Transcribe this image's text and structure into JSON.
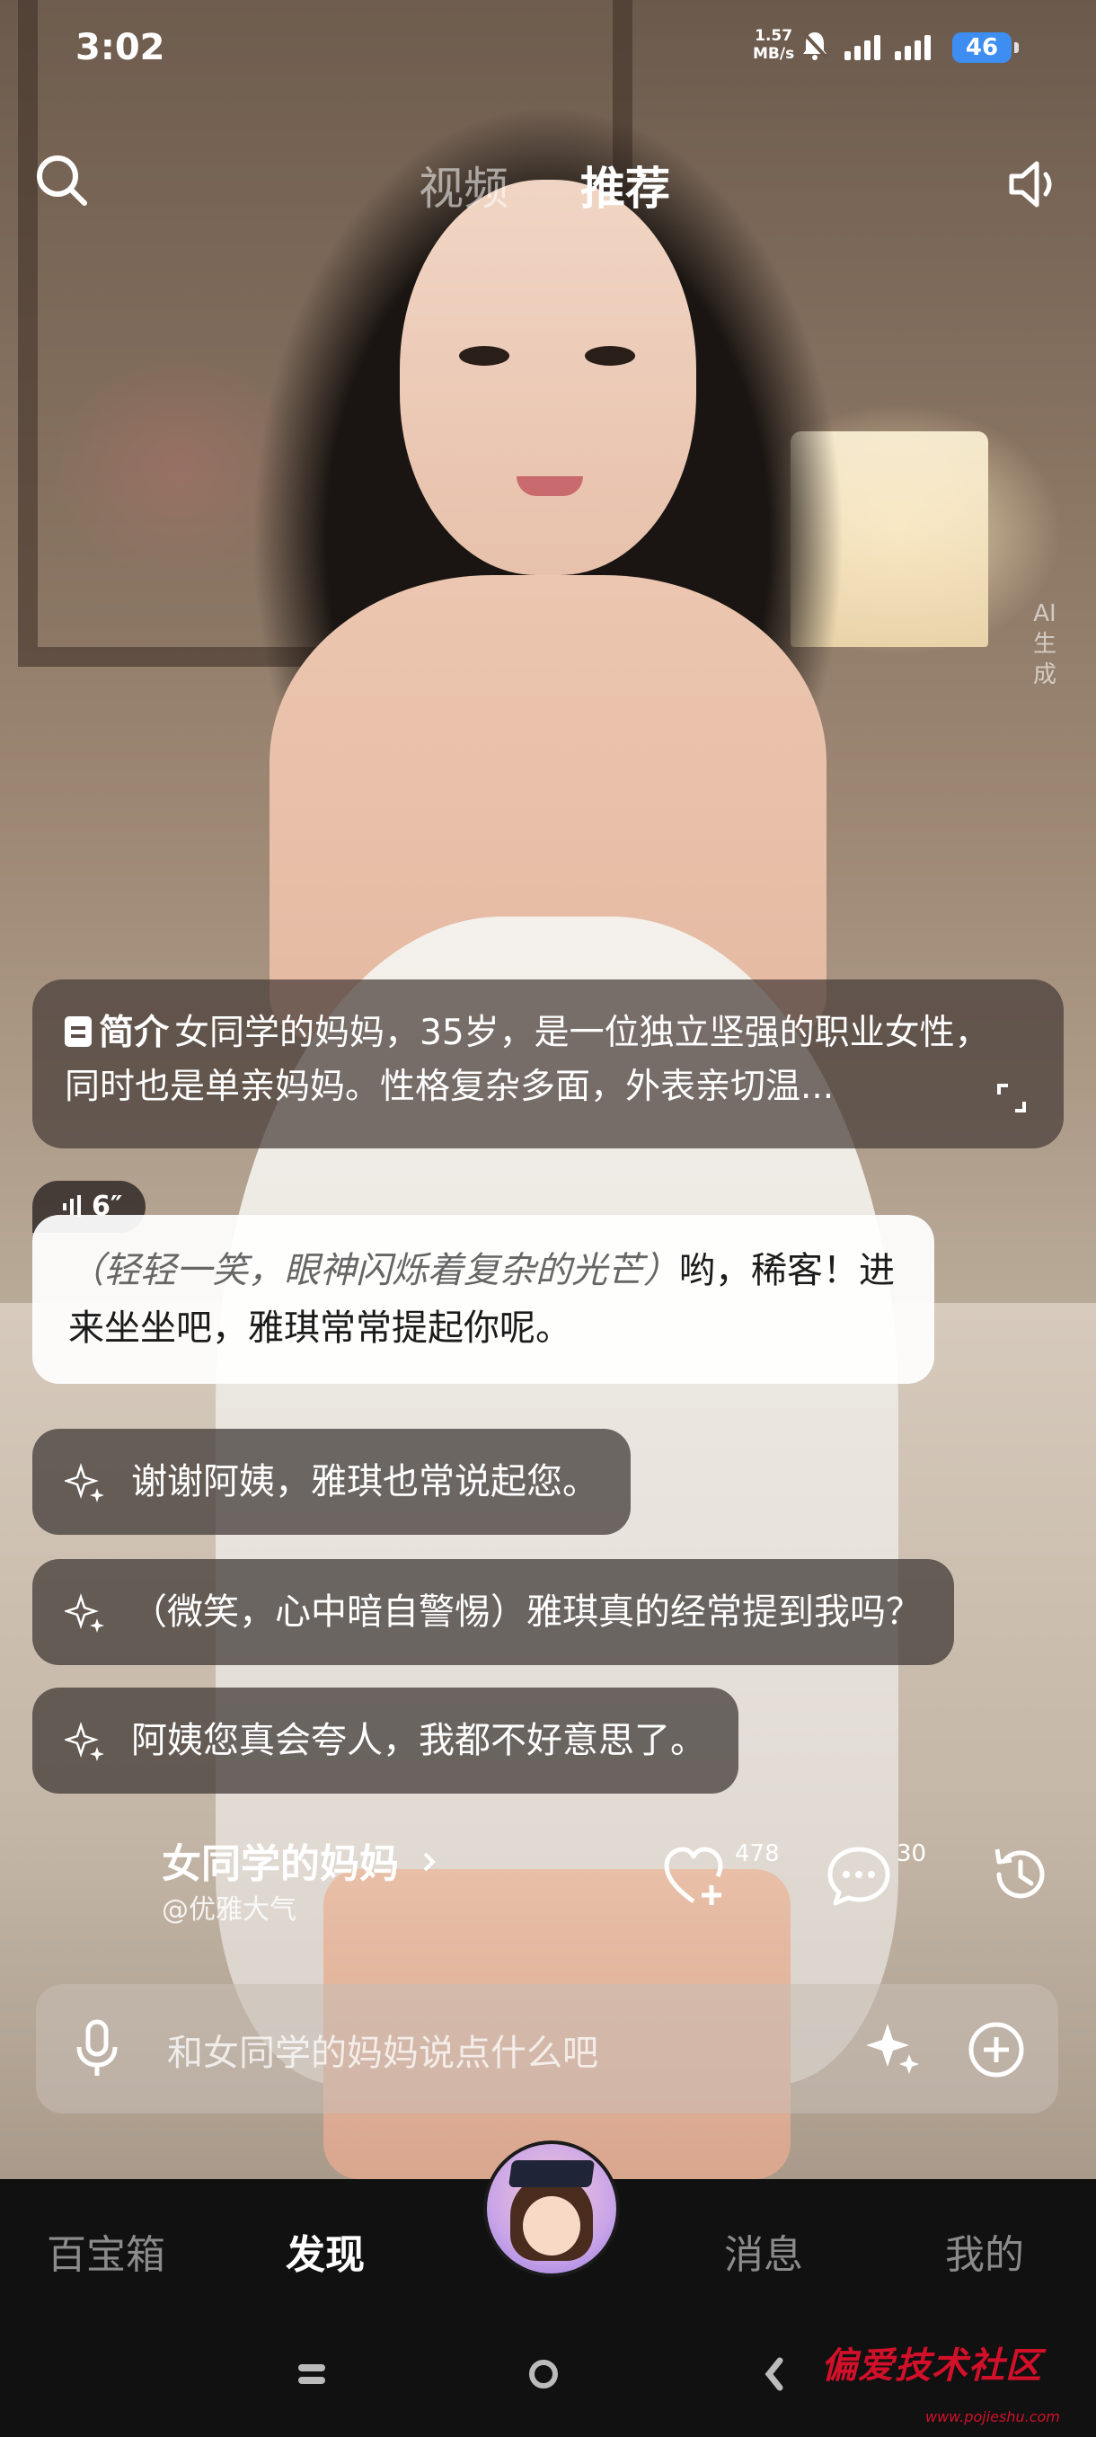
{
  "status_bar": {
    "time": "3:02",
    "net_speed_value": "1.57",
    "net_speed_unit": "MB/s",
    "battery": "46"
  },
  "top_nav": {
    "tabs": [
      {
        "label": "视频",
        "active": false
      },
      {
        "label": "推荐",
        "active": true
      }
    ],
    "search_icon": "search-icon",
    "sound_icon": "speaker-icon"
  },
  "ai_badge": "AI生成",
  "intro": {
    "label": "简介",
    "text": "女同学的妈妈，35岁，是一位独立坚强的职业女性，同时也是单亲妈妈。性格复杂多面，外表亲切温..."
  },
  "message": {
    "voice_duration": "6″",
    "action": "（轻轻一笑，眼神闪烁着复杂的光芒）",
    "text": "哟，稀客！进来坐坐吧，雅琪常常提起你呢。"
  },
  "suggestions": [
    "谢谢阿姨，雅琪也常说起您。",
    "（微笑，心中暗自警惕）雅琪真的经常提到我吗？",
    "阿姨您真会夸人，我都不好意思了。"
  ],
  "character": {
    "name": "女同学的妈妈",
    "handle": "@优雅大气",
    "likes": "478",
    "comments": "30"
  },
  "input": {
    "placeholder": "和女同学的妈妈说点什么吧"
  },
  "bottom_nav": {
    "items": [
      "百宝箱",
      "发现",
      "消息",
      "我的"
    ],
    "active": "发现"
  },
  "watermark": {
    "text": "偏爱技术社区",
    "url": "www.pojieshu.com"
  }
}
